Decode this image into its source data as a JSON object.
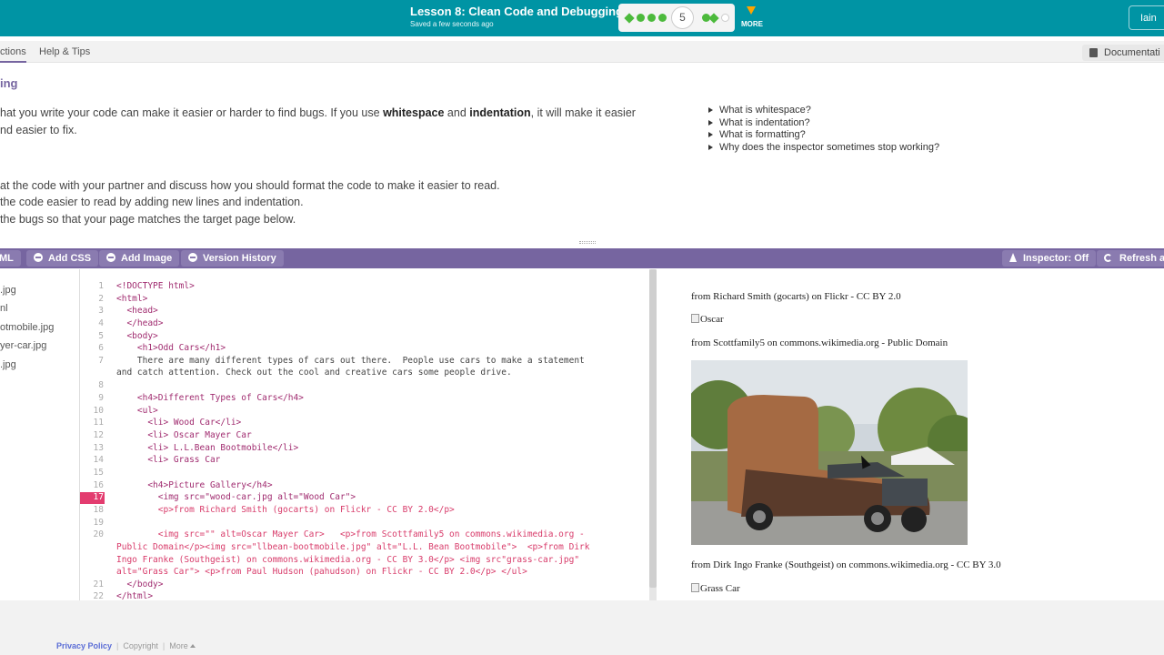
{
  "header": {
    "lesson_title": "Lesson 8: Clean Code and Debugging",
    "saved_status": "Saved a few seconds ago",
    "current_level": "5",
    "more_label": "MORE",
    "user_label": "Iain",
    "colors": {
      "header_bg": "#0094a4",
      "progress_green": "#4cba3c",
      "accent_purple": "#7665a0"
    }
  },
  "tabs": {
    "instructions_label": "ctions",
    "help_label": "Help & Tips",
    "documentation_label": "Documentati"
  },
  "instructions": {
    "title": "ing",
    "para_start": "hat you write your code can make it easier or harder to find bugs. If you use ",
    "whitespace": "whitespace",
    "and": " and ",
    "indentation": "indentation",
    "para_end": ", it will make it easier",
    "para_line2": "nd easier to fix.",
    "faq": [
      "What is whitespace?",
      "What is indentation?",
      "What is formatting?",
      "Why does the inspector sometimes stop working?"
    ],
    "steps": [
      "at the code with your partner and discuss how you should format the code to make it easier to read.",
      "the code easier to read by adding new lines and indentation.",
      " the bugs so that your page matches the target page below."
    ]
  },
  "toolbar": {
    "add_html_label": "ML",
    "add_css_label": "Add CSS",
    "add_image_label": "Add Image",
    "version_history_label": "Version History",
    "inspector_label": "Inspector: Off",
    "refresh_label": "Refresh ar"
  },
  "files": [
    ".jpg",
    "nl",
    "otmobile.jpg",
    "yer-car.jpg",
    ".jpg"
  ],
  "code": {
    "error_line": "17",
    "line_numbers": [
      "1",
      "2",
      "3",
      "4",
      "5",
      "6",
      "7",
      "8",
      "9",
      "10",
      "11",
      "12",
      "13",
      "14",
      "15",
      "16",
      "17",
      "18",
      "19",
      "20",
      "21",
      "22"
    ],
    "lines": [
      "<!DOCTYPE html>",
      "<html>",
      "  <head>",
      "  </head>",
      "  <body>",
      "    <h1>Odd Cars</h1>",
      "    There are many different types of cars out there.  People use cars to make a statement",
      "and catch attention. Check out the cool and creative cars some people drive.",
      "    <h4>Different Types of Cars</h4>",
      "    <ul>",
      "      <li> Wood Car</li>",
      "      <li> Oscar Mayer Car",
      "      <li> L.L.Bean Bootmobile</li>",
      "      <li> Grass Car",
      "      <h4>Picture Gallery</h4>",
      "        <img src=\"wood-car.jpg alt=\"Wood Car\">",
      "        <p>from Richard Smith (gocarts) on Flickr - CC BY 2.0</p>",
      "        <img src=\"\" alt=Oscar Mayer Car>   <p>from Scottfamily5 on commons.wikimedia.org -",
      "Public Domain</p><img src=\"llbean-bootmobile.jpg\" alt=\"L.L. Bean Bootmobile\">  <p>from Dirk",
      "Ingo Franke (Southgeist) on commons.wikimedia.org - CC BY 3.0</p> <img src\"grass-car.jpg\"",
      "alt=\"Grass Car\"> <p>from Paul Hudson (pahudson) on Flickr - CC BY 2.0</p> </ul>",
      "  </body>",
      "</html>"
    ]
  },
  "preview": {
    "caption1": "from Richard Smith (gocarts) on Flickr - CC BY 2.0",
    "oscar_alt": "Oscar",
    "caption2": "from Scottfamily5 on commons.wikimedia.org - Public Domain",
    "caption3": "from Dirk Ingo Franke (Southgeist) on commons.wikimedia.org - CC BY 3.0",
    "grass_alt": "Grass Car"
  },
  "footer": {
    "privacy": "Privacy Policy",
    "copyright": "Copyright",
    "more": "More"
  }
}
